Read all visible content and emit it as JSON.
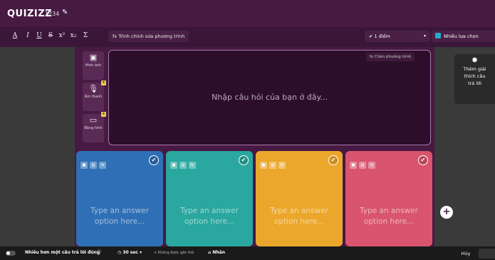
{
  "header": {
    "logo": "QUIZIZZ",
    "quiz_name": "1234",
    "edit_icon": "pencil-icon"
  },
  "toolbar": {
    "format_buttons": [
      {
        "label": "A",
        "icon": "underline-color-icon"
      },
      {
        "label": "I",
        "icon": "italic-icon"
      },
      {
        "label": "U",
        "icon": "underline-icon"
      },
      {
        "label": "S",
        "icon": "strikethrough-icon"
      },
      {
        "label": "x²",
        "icon": "superscript-icon"
      },
      {
        "label": "x₂",
        "icon": "subscript-icon"
      },
      {
        "label": "Σ",
        "icon": "sigma-icon"
      }
    ],
    "equation_editor": "fx Trình chỉnh sửa phương trình",
    "points": "1 điểm",
    "question_type": "Nhiều lựa chọn"
  },
  "media": [
    {
      "label": "Hình ảnh",
      "icon": "image-icon"
    },
    {
      "label": "Âm thanh",
      "icon": "microphone-icon"
    },
    {
      "label": "Băng hình",
      "icon": "video-icon"
    }
  ],
  "question": {
    "placeholder": "Nhập câu hỏi của bạn ở đây...",
    "insert_equation": "fx Chèn phương trình"
  },
  "answers": [
    {
      "placeholder_1": "Type an answer",
      "placeholder_2": "option here...",
      "color": "#2f6fb5"
    },
    {
      "placeholder_1": "Type an answer",
      "placeholder_2": "option here...",
      "color": "#2aa79e"
    },
    {
      "placeholder_1": "Type an answer",
      "placeholder_2": "option here...",
      "color": "#eba72b"
    },
    {
      "placeholder_1": "Type an answer",
      "placeholder_2": "option here...",
      "color": "#d9546e"
    }
  ],
  "explanation": {
    "label_1": "Thêm giải",
    "label_2": "thích câu",
    "label_3": "trả lời"
  },
  "bottom": {
    "multiple_correct": "Nhiều hơn một câu trả lời đúng",
    "time": "30 sec",
    "untagged": "× Không được gắn thẻ",
    "tag": "Nhãn",
    "cancel": "Hủy"
  }
}
